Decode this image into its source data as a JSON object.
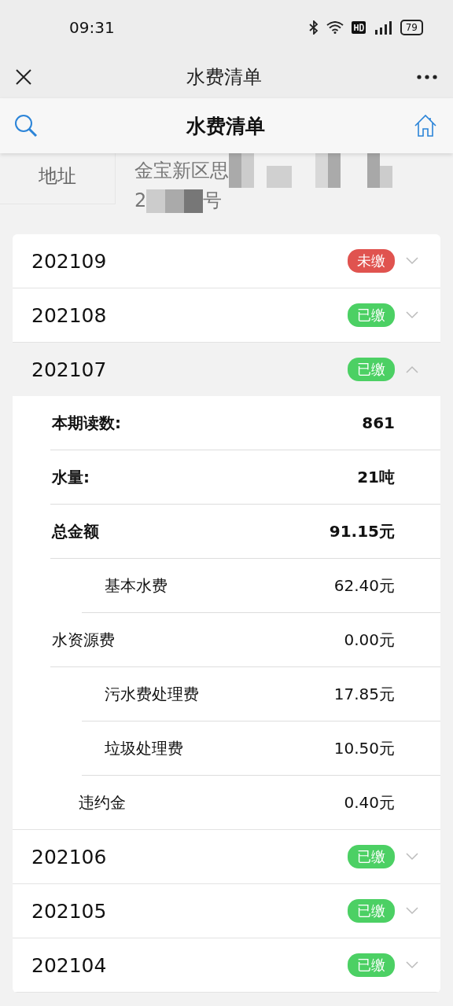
{
  "status_bar": {
    "time": "09:31",
    "battery": "79"
  },
  "nav_bar": {
    "title": "水费清单"
  },
  "header": {
    "title": "水费清单"
  },
  "address": {
    "label": "地址",
    "line_1": "金宝新区思",
    "line_2_start": "2",
    "line_2_end": "号"
  },
  "months": [
    {
      "month": "202109",
      "status": "未缴",
      "paid": false,
      "expanded": false
    },
    {
      "month": "202108",
      "status": "已缴",
      "paid": true,
      "expanded": false
    },
    {
      "month": "202107",
      "status": "已缴",
      "paid": true,
      "expanded": true,
      "details": [
        {
          "label": "本期读数:",
          "value": "861",
          "kind": "bold"
        },
        {
          "label": "水量:",
          "value": "21吨",
          "kind": "bold"
        },
        {
          "label": "总金额",
          "value": "91.15元",
          "kind": "bold"
        },
        {
          "label": "基本水费",
          "value": "62.40元",
          "kind": "sub"
        },
        {
          "label": "水资源费",
          "value": "0.00元",
          "kind": "main"
        },
        {
          "label": "污水费处理费",
          "value": "17.85元",
          "kind": "sub"
        },
        {
          "label": "垃圾处理费",
          "value": "10.50元",
          "kind": "sub"
        },
        {
          "label": "违约金",
          "value": "0.40元",
          "kind": "minor"
        }
      ]
    },
    {
      "month": "202106",
      "status": "已缴",
      "paid": true,
      "expanded": false
    },
    {
      "month": "202105",
      "status": "已缴",
      "paid": true,
      "expanded": false
    },
    {
      "month": "202104",
      "status": "已缴",
      "paid": true,
      "expanded": false
    }
  ]
}
